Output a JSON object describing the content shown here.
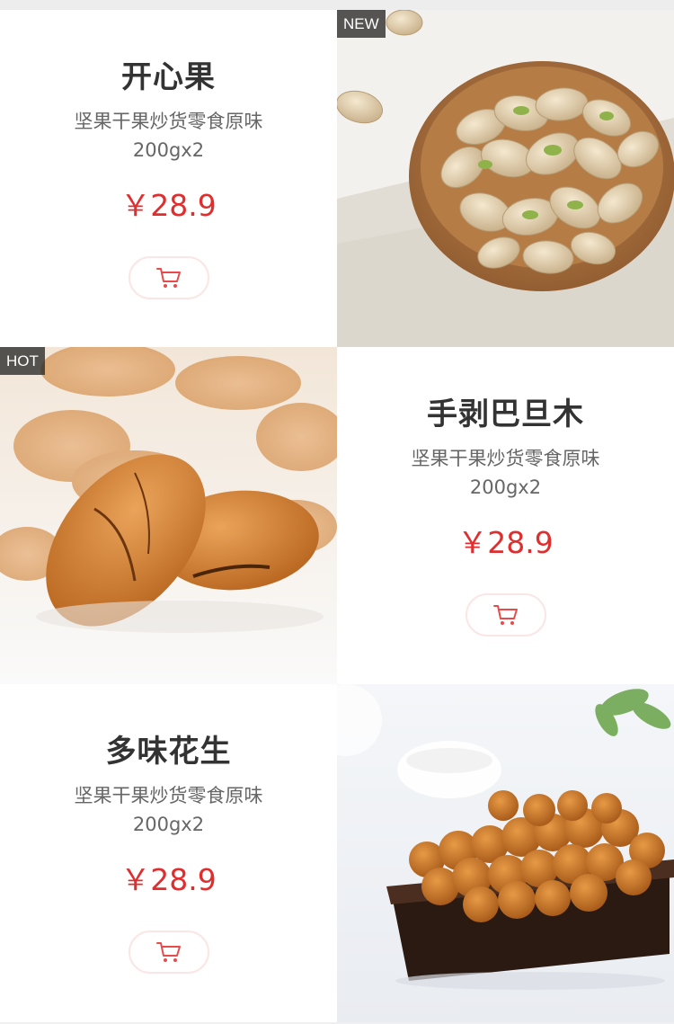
{
  "products": [
    {
      "name": "开心果",
      "desc_line1": "坚果干果炒货零食原味",
      "desc_line2": "200gx2",
      "price": "￥28.9",
      "badge": "NEW",
      "icon": "cart-icon",
      "image": "pistachio-bowl"
    },
    {
      "name": "手剥巴旦木",
      "desc_line1": "坚果干果炒货零食原味",
      "desc_line2": "200gx2",
      "price": "￥28.9",
      "badge": "HOT",
      "icon": "cart-icon",
      "image": "almond-shells"
    },
    {
      "name": "多味花生",
      "desc_line1": "坚果干果炒货零食原味",
      "desc_line2": "200gx2",
      "price": "￥28.9",
      "badge": "",
      "icon": "cart-icon",
      "image": "coated-peanuts-dish"
    }
  ],
  "colors": {
    "price": "#e02e2e",
    "cart_icon": "#e84b4b",
    "cart_border": "#fbe6e6",
    "badge_bg": "#3a3a3a"
  }
}
